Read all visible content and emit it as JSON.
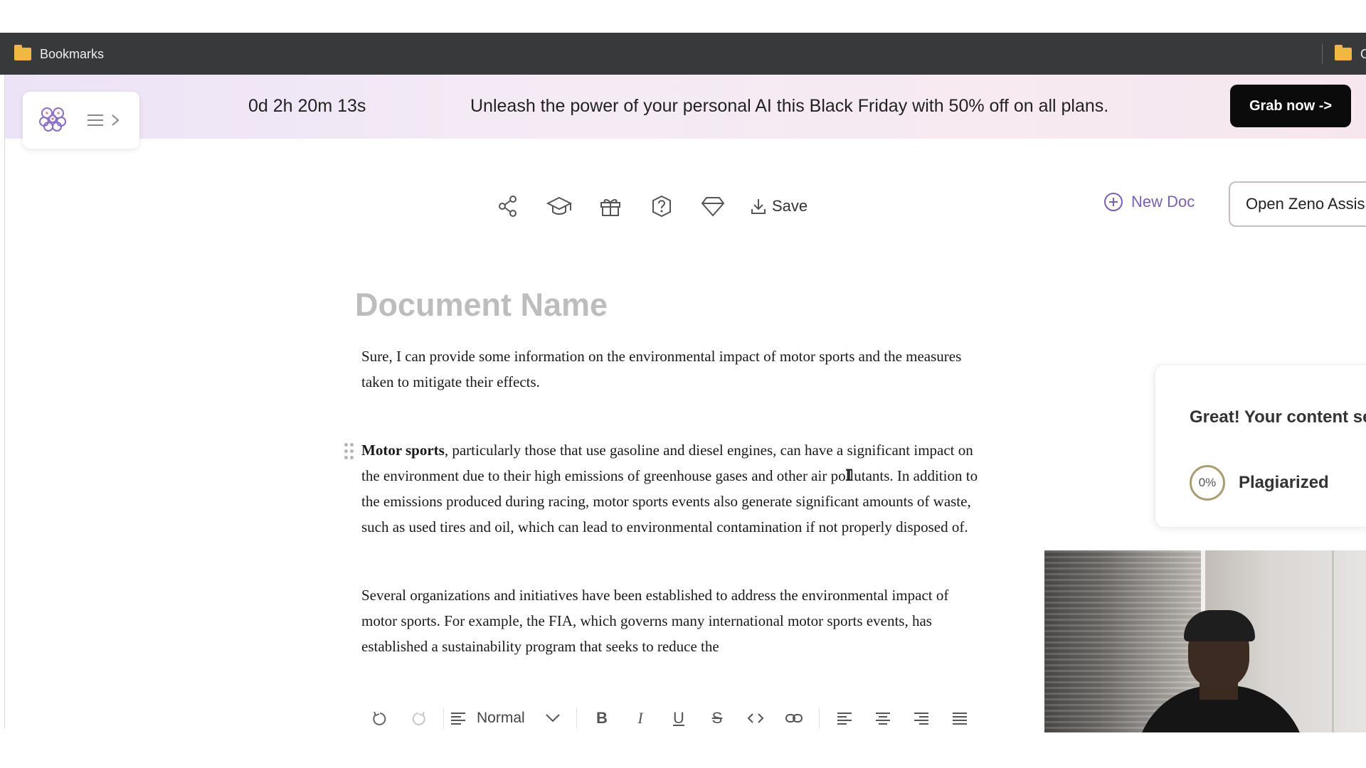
{
  "bookmarks_bar": {
    "left_label": "Bookmarks",
    "right_label": "O"
  },
  "promo": {
    "countdown": "0d 2h 20m 13s",
    "message": "Unleash the power of your personal AI this Black Friday with 50% off on all plans.",
    "cta": "Grab now ->"
  },
  "toolbar": {
    "icons": [
      "share-icon",
      "graduation-cap-icon",
      "gift-icon",
      "help-icon",
      "diamond-icon"
    ],
    "save_label": "Save",
    "new_doc_label": "New Doc",
    "zeno_label": "Open Zeno Assis"
  },
  "document": {
    "name_placeholder": "Document Name",
    "paragraphs": [
      {
        "text": "Sure, I can provide some information on the environmental impact of motor sports and the measures taken to mitigate their effects."
      },
      {
        "bold": "Motor sports",
        "text": ", particularly those that use gasoline and diesel engines, can have a significant impact on the environment due to their high emissions of greenhouse gases and other air pollutants. In addition to the emissions produced during racing, motor sports events also generate significant amounts of waste, such as used tires and oil, which can lead to environmental contamination if not properly disposed of."
      },
      {
        "text": "Several organizations and initiatives have been established to address the environmental impact of motor sports. For example, the FIA, which governs many international motor sports events, has established a sustainability program that seeks to reduce the"
      }
    ]
  },
  "plagiarism": {
    "title": "Great! Your content se unique",
    "percent": "0%",
    "label": "Plagiarized",
    "ring_color": "#a99e70"
  },
  "format_bar": {
    "style_value": "Normal"
  },
  "colors": {
    "accent": "#7a5fb6",
    "cta_bg": "#0b0b0b",
    "bookmark_bar": "#38393b"
  }
}
